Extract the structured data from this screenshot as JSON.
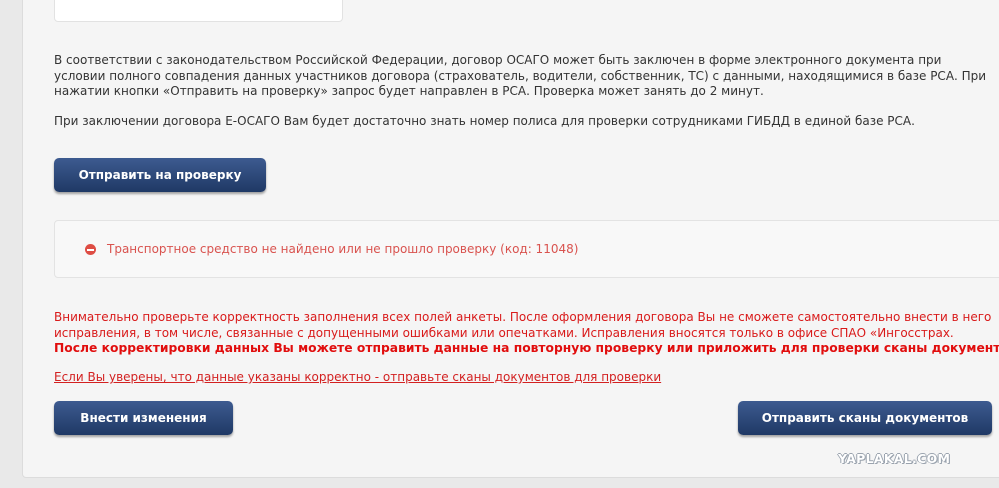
{
  "info": {
    "paragraph1": "В соответствии с законодательством Российской Федерации, договор ОСАГО может быть заключен в форме электронного документа при условии полного совпадения данных участников договора (страхователь, водители, собственник, ТС) с данными, находящимися в базе РСА. При нажатии кнопки «Отправить на проверку» запрос будет направлен в РСА. Проверка может занять до 2 минут.",
    "paragraph2": "При заключении договора Е-ОСАГО Вам будет достаточно знать номер полиса для проверки сотрудниками ГИБДД в единой базе РСА."
  },
  "buttons": {
    "send_check": "Отправить на проверку",
    "edit": "Внести изменения",
    "send_scans": "Отправить сканы документов"
  },
  "error": {
    "icon": "minus-circle-icon",
    "message": "Транспортное средство не найдено или не прошло проверку (код: 11048)"
  },
  "warning": {
    "text": "Внимательно проверьте корректность заполнения всех полей анкеты. После оформления договора Вы не сможете самостоятельно внести в него исправления, в том числе, связанные с допущенными ошибками или опечатками. Исправления вносятся только в офисе СПАО «Ингосстрах.",
    "bold": "После корректировки данных Вы можете отправить данные на повторную проверку или приложить для проверки сканы документов."
  },
  "link": {
    "text": "Если Вы уверены, что данные указаны корректно - отправьте сканы документов для проверки"
  },
  "watermark": "YAPLAKAL.COM",
  "colors": {
    "button": "#2b4777",
    "error": "#d9534f",
    "warning": "#d91a1a"
  }
}
